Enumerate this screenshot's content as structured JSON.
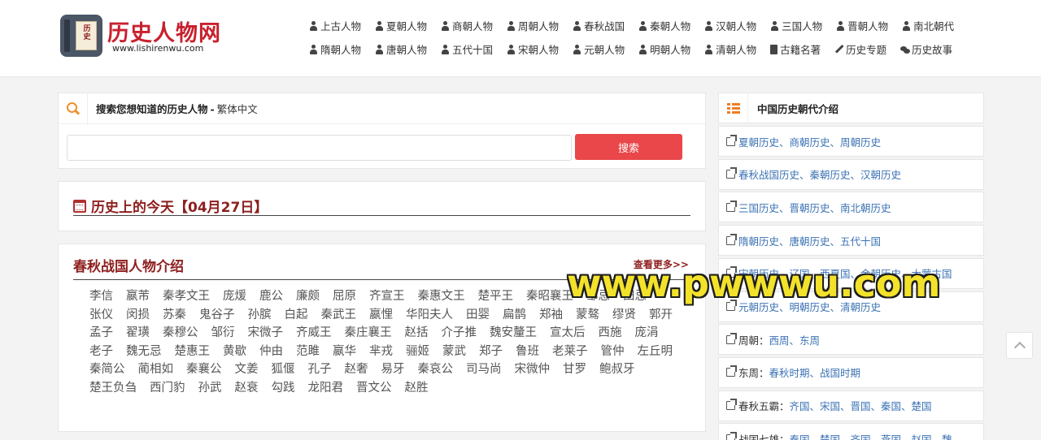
{
  "header": {
    "logo_book_text": "历史",
    "logo_title": "历史人物网",
    "logo_url": "www.lishirenwu.com",
    "nav_row1": [
      {
        "label": "上古人物",
        "icon": "person-icon"
      },
      {
        "label": "夏朝人物",
        "icon": "person-icon"
      },
      {
        "label": "商朝人物",
        "icon": "person-icon"
      },
      {
        "label": "周朝人物",
        "icon": "person-icon"
      },
      {
        "label": "春秋战国",
        "icon": "person-icon"
      },
      {
        "label": "秦朝人物",
        "icon": "person-icon"
      },
      {
        "label": "汉朝人物",
        "icon": "person-icon"
      },
      {
        "label": "三国人物",
        "icon": "person-icon"
      },
      {
        "label": "晋朝人物",
        "icon": "person-icon"
      },
      {
        "label": "南北朝代",
        "icon": "person-icon"
      }
    ],
    "nav_row2": [
      {
        "label": "隋朝人物",
        "icon": "person-icon"
      },
      {
        "label": "唐朝人物",
        "icon": "person-icon"
      },
      {
        "label": "五代十国",
        "icon": "person-icon"
      },
      {
        "label": "宋朝人物",
        "icon": "person-icon"
      },
      {
        "label": "元朝人物",
        "icon": "person-icon"
      },
      {
        "label": "明朝人物",
        "icon": "person-icon"
      },
      {
        "label": "清朝人物",
        "icon": "person-icon"
      },
      {
        "label": "古籍名著",
        "icon": "book-icon"
      },
      {
        "label": "历史专题",
        "icon": "pencil-icon"
      },
      {
        "label": "历史故事",
        "icon": "chat-icon"
      }
    ]
  },
  "search": {
    "title": "搜索您想知道的历史人物",
    "separator": "-",
    "traditional_link": "繁体中文",
    "input_value": "",
    "button_label": "搜索"
  },
  "today": {
    "title": "历史上的今天【04月27日】"
  },
  "people": {
    "title": "春秋战国人物介绍",
    "more_label": "查看更多>>",
    "names": [
      "李信",
      "嬴芾",
      "秦孝文王",
      "庞煖",
      "鹿公",
      "廉颇",
      "屈原",
      "齐宣王",
      "秦惠文王",
      "楚平王",
      "秦昭襄王",
      "邹忌",
      "田忌",
      "张仪",
      "闵损",
      "苏秦",
      "鬼谷子",
      "孙膑",
      "白起",
      "秦武王",
      "嬴悝",
      "华阳夫人",
      "田婴",
      "扁鹊",
      "郑袖",
      "蒙骜",
      "缪贤",
      "郭开",
      "孟子",
      "翟璜",
      "秦穆公",
      "邹衍",
      "宋微子",
      "齐威王",
      "秦庄襄王",
      "赵括",
      "介子推",
      "魏安釐王",
      "宣太后",
      "西施",
      "庞涓",
      "老子",
      "魏无忌",
      "楚惠王",
      "黄歇",
      "仲由",
      "范雎",
      "嬴华",
      "芈戎",
      "骊姬",
      "蒙武",
      "郑子",
      "鲁班",
      "老莱子",
      "管仲",
      "左丘明",
      "秦简公",
      "蔺相如",
      "秦襄公",
      "文姜",
      "狐偃",
      "孔子",
      "赵奢",
      "易牙",
      "秦哀公",
      "司马尚",
      "宋微仲",
      "甘罗",
      "鲍叔牙",
      "楚王负刍",
      "西门豹",
      "孙武",
      "赵衰",
      "勾践",
      "龙阳君",
      "晋文公",
      "赵胜"
    ]
  },
  "sidebar": {
    "title": "中国历史朝代介绍",
    "items": [
      {
        "label": "",
        "links": "夏朝历史、商朝历史、周朝历史"
      },
      {
        "label": "",
        "links": "春秋战国历史、秦朝历史、汉朝历史"
      },
      {
        "label": "",
        "links": "三国历史、晋朝历史、南北朝历史"
      },
      {
        "label": "",
        "links": "隋朝历史、唐朝历史、五代十国"
      },
      {
        "label": "",
        "links": "宋朝历史、辽国、西夏国、金朝历史、大蒙古国"
      },
      {
        "label": "",
        "links": "元朝历史、明朝历史、清朝历史"
      },
      {
        "label": "周朝：",
        "links": "西周、东周"
      },
      {
        "label": "东周：",
        "links": "春秋时期、战国时期"
      },
      {
        "label": "春秋五霸：",
        "links": "齐国、宋国、晋国、秦国、楚国"
      },
      {
        "label": "战国七雄：",
        "links": "秦国、楚国、齐国、燕国、赵国、魏"
      }
    ]
  },
  "watermark": "www.pwwwu.com",
  "colors": {
    "accent_red": "#e9474a",
    "title_red": "#8e1f1f",
    "link_blue": "#3c73b4",
    "icon_orange": "#f0902a"
  }
}
